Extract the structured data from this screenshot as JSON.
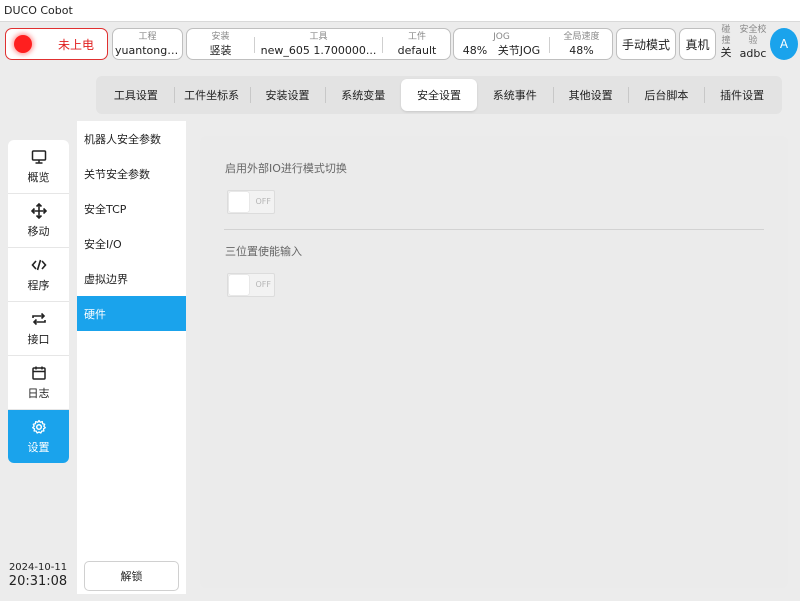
{
  "app": {
    "title": "DUCO Cobot"
  },
  "topbar": {
    "power_status": "未上电",
    "project": {
      "label": "工程",
      "value": "yuantongda..."
    },
    "install": {
      "label": "安装",
      "value": "竖装"
    },
    "tool": {
      "label": "工具",
      "value": "new_605   1.700000..."
    },
    "workpiece": {
      "label": "工件",
      "value": "default"
    },
    "jog": {
      "label": "JOG",
      "speed": "48%",
      "mode": "关节JOG"
    },
    "global_speed": {
      "label": "全局速度",
      "value": "48%"
    },
    "mode_button": "手动模式",
    "real_button": "真机",
    "collision": {
      "label": "碰撞",
      "value": "关"
    },
    "safety": {
      "label": "安全校验",
      "value": "adbc"
    },
    "avatar": "A"
  },
  "tabs": [
    {
      "label": "工具设置",
      "active": false
    },
    {
      "label": "工件坐标系",
      "active": false
    },
    {
      "label": "安装设置",
      "active": false
    },
    {
      "label": "系统变量",
      "active": false
    },
    {
      "label": "安全设置",
      "active": true
    },
    {
      "label": "系统事件",
      "active": false
    },
    {
      "label": "其他设置",
      "active": false
    },
    {
      "label": "后台脚本",
      "active": false
    },
    {
      "label": "插件设置",
      "active": false
    }
  ],
  "leftnav": {
    "items": [
      {
        "label": "概览",
        "icon": "monitor-icon"
      },
      {
        "label": "移动",
        "icon": "move-icon"
      },
      {
        "label": "程序",
        "icon": "code-icon"
      },
      {
        "label": "接口",
        "icon": "swap-icon"
      },
      {
        "label": "日志",
        "icon": "calendar-icon"
      },
      {
        "label": "设置",
        "icon": "gear-icon"
      }
    ],
    "active_index": 5
  },
  "datetime": {
    "date": "2024-10-11",
    "time": "20:31:08"
  },
  "submenu": {
    "items": [
      "机器人安全参数",
      "关节安全参数",
      "安全TCP",
      "安全I/O",
      "虚拟边界",
      "硬件"
    ],
    "active_index": 5,
    "unlock": "解锁"
  },
  "content": {
    "setting1": {
      "label": "启用外部IO进行模式切换",
      "state": "OFF"
    },
    "setting2": {
      "label": "三位置使能输入",
      "state": "OFF"
    }
  },
  "colors": {
    "accent": "#1aa3ec",
    "danger": "#e02020"
  }
}
